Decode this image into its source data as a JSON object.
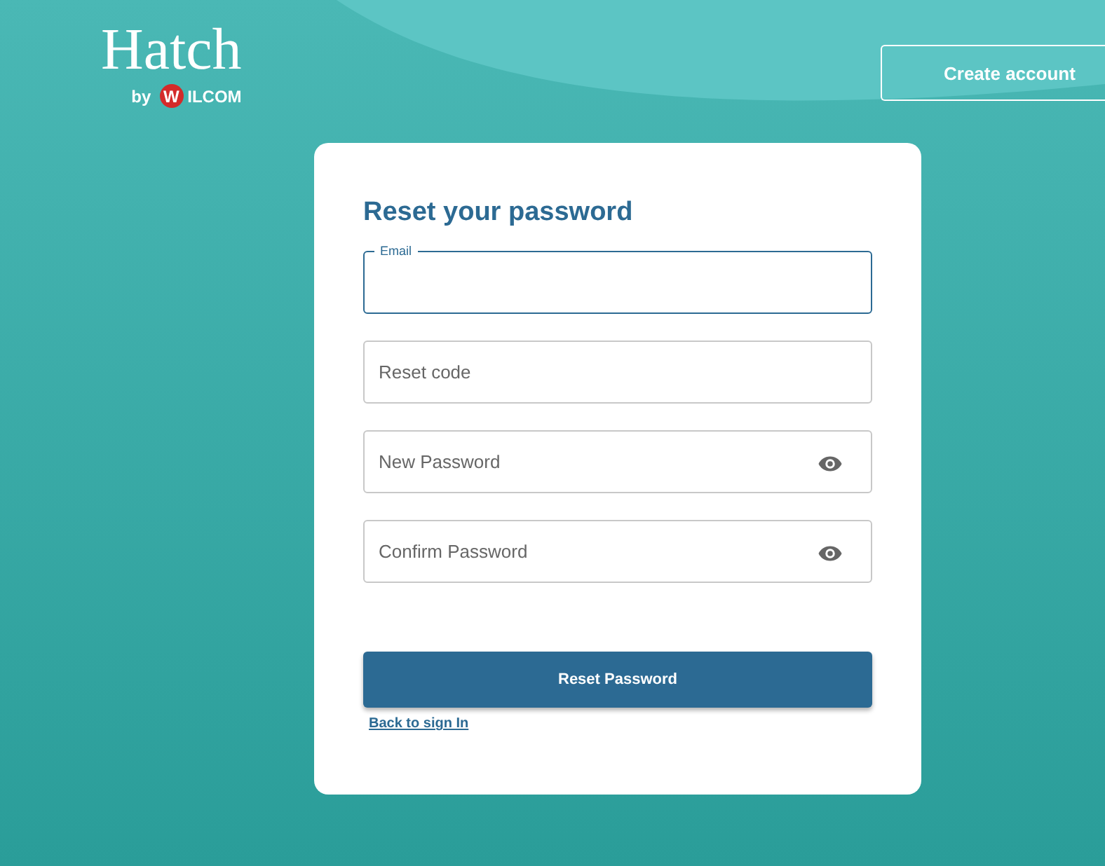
{
  "logo": {
    "name": "Hatch",
    "by": "by",
    "brand_initial": "W",
    "brand_rest": "ILCOM"
  },
  "header": {
    "create_account": "Create account"
  },
  "form": {
    "title": "Reset your password",
    "fields": [
      {
        "label": "Email",
        "focused": true,
        "reveal_toggle": false
      },
      {
        "label": "Reset code",
        "focused": false,
        "reveal_toggle": false
      },
      {
        "label": "New Password",
        "focused": false,
        "reveal_toggle": true
      },
      {
        "label": "Confirm Password",
        "focused": false,
        "reveal_toggle": true
      }
    ],
    "submit": "Reset Password",
    "back_link": "Back to sign In"
  }
}
